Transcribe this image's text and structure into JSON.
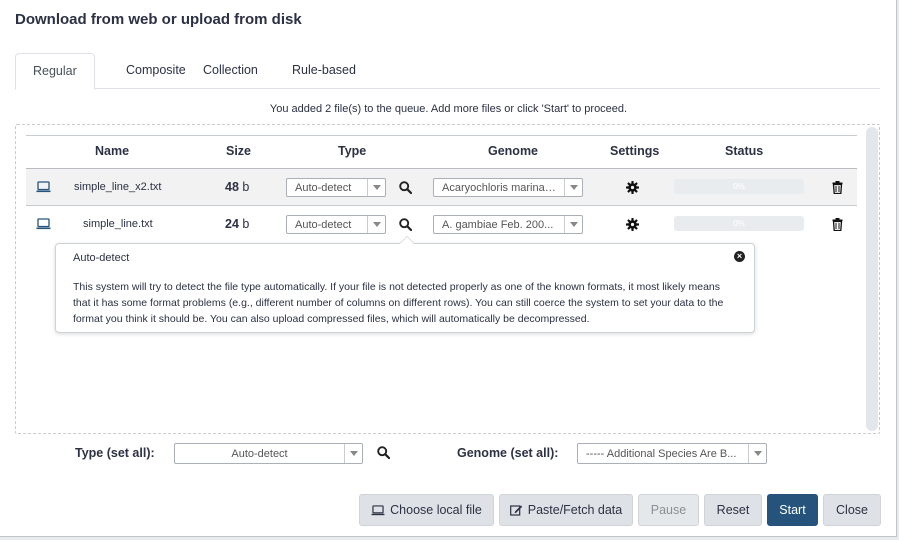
{
  "dialog": {
    "title": "Download from web or upload from disk"
  },
  "tabs": [
    {
      "label": "Regular",
      "active": true
    },
    {
      "label": "Composite",
      "active": false
    },
    {
      "label": "Collection",
      "active": false
    },
    {
      "label": "Rule-based",
      "active": false
    }
  ],
  "queue_message": "You added 2 file(s) to the queue. Add more files or click 'Start' to proceed.",
  "table": {
    "headers": {
      "name": "Name",
      "size": "Size",
      "type": "Type",
      "genome": "Genome",
      "settings": "Settings",
      "status": "Status"
    },
    "rows": [
      {
        "name": "simple_line_x2.txt",
        "size_num": "48",
        "size_unit": "b",
        "type": "Auto-detect",
        "genome": "Acaryochloris marina ...",
        "progress": "0%"
      },
      {
        "name": "simple_line.txt",
        "size_num": "24",
        "size_unit": "b",
        "type": "Auto-detect",
        "genome": "A. gambiae Feb. 200...",
        "progress": "0%"
      }
    ]
  },
  "popover": {
    "title": "Auto-detect",
    "body": "This system will try to detect the file type automatically. If your file is not detected properly as one of the known formats, it most likely means that it has some format problems (e.g., different number of columns on different rows). You can still coerce the system to set your data to the format you think it should be. You can also upload compressed files, which will automatically be decompressed."
  },
  "set_all": {
    "type_label": "Type (set all):",
    "type_value": "Auto-detect",
    "genome_label": "Genome (set all):",
    "genome_value": "----- Additional Species Are B..."
  },
  "buttons": {
    "choose_local": "Choose local file",
    "paste_fetch": "Paste/Fetch data",
    "pause": "Pause",
    "reset": "Reset",
    "start": "Start",
    "close": "Close"
  },
  "colors": {
    "primary_button": "#25537b",
    "text": "#2c3143",
    "row_highlight": "#f2f2f2"
  },
  "icons": [
    "laptop-icon",
    "search-icon",
    "gear-icon",
    "trash-icon",
    "close-icon",
    "edit-icon"
  ]
}
